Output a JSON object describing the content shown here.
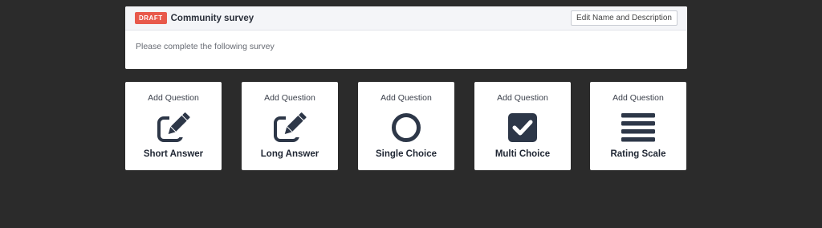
{
  "survey": {
    "badge": "DRAFT",
    "title": "Community survey",
    "edit_button": "Edit Name and Description",
    "description": "Please complete the following survey"
  },
  "question_types": [
    {
      "add_label": "Add Question",
      "label": "Short Answer",
      "icon": "edit-icon"
    },
    {
      "add_label": "Add Question",
      "label": "Long Answer",
      "icon": "edit-icon"
    },
    {
      "add_label": "Add Question",
      "label": "Single Choice",
      "icon": "circle-icon"
    },
    {
      "add_label": "Add Question",
      "label": "Multi Choice",
      "icon": "checkbox-icon"
    },
    {
      "add_label": "Add Question",
      "label": "Rating Scale",
      "icon": "list-icon"
    }
  ],
  "colors": {
    "background": "#2b2b2b",
    "icon": "#2d3748",
    "badge": "#e8594b"
  }
}
